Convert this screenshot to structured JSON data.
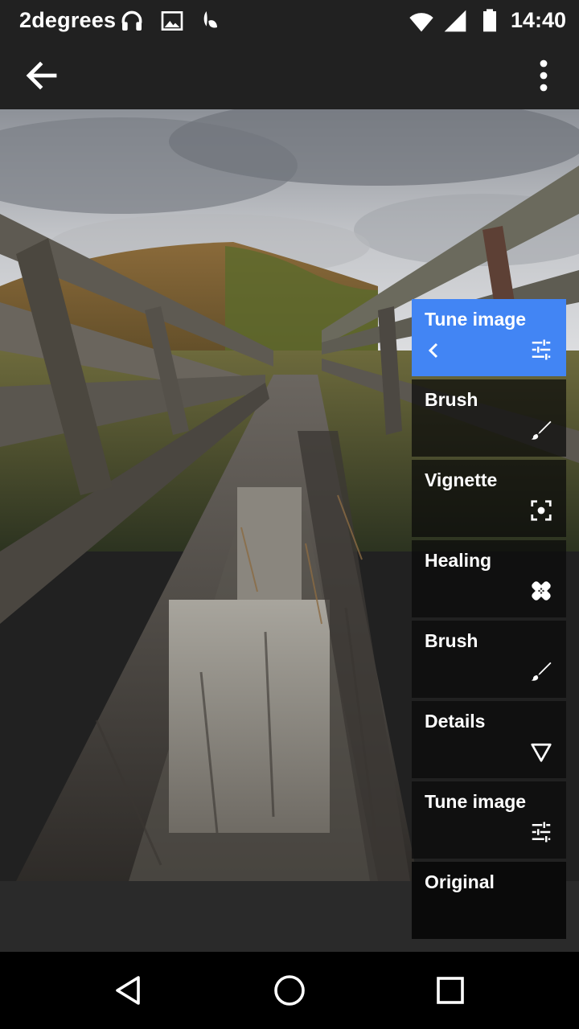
{
  "status_bar": {
    "carrier": "2degrees",
    "time": "14:40",
    "icons": [
      "headphones-icon",
      "image-icon",
      "leaf-icon",
      "wifi-icon",
      "signal-icon",
      "battery-icon"
    ]
  },
  "app_bar": {
    "back_icon": "arrow-back-icon",
    "more_icon": "more-vert-icon"
  },
  "stack": {
    "items": [
      {
        "label": "Tune image",
        "icon": "tune-icon",
        "active": true
      },
      {
        "label": "Brush",
        "icon": "brush-icon"
      },
      {
        "label": "Vignette",
        "icon": "vignette-icon"
      },
      {
        "label": "Healing",
        "icon": "healing-icon"
      },
      {
        "label": "Brush",
        "icon": "brush-icon"
      },
      {
        "label": "Details",
        "icon": "details-icon"
      },
      {
        "label": "Tune image",
        "icon": "tune-icon"
      },
      {
        "label": "Original",
        "icon": ""
      }
    ]
  },
  "nav_bar": {
    "icons": [
      "nav-back-icon",
      "nav-home-icon",
      "nav-recents-icon"
    ]
  },
  "colors": {
    "accent": "#4285f4",
    "bar": "#212121"
  }
}
